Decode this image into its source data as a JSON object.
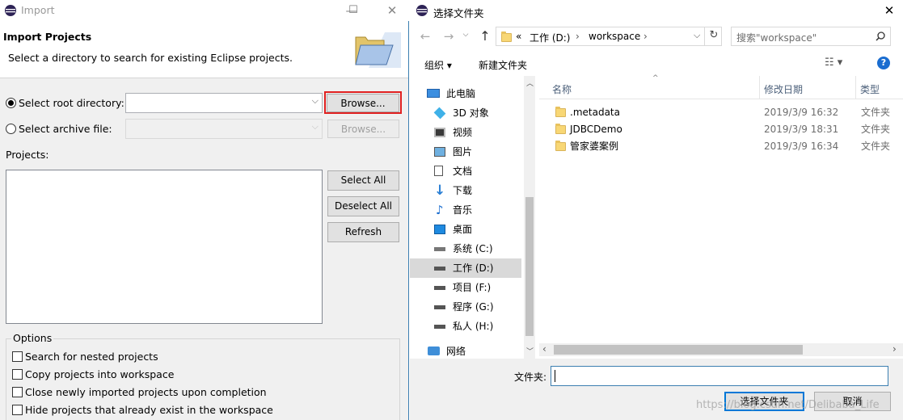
{
  "eclipse": {
    "title": "Import",
    "header_title": "Import Projects",
    "header_desc": "Select a directory to search for existing Eclipse projects.",
    "select_root_label": "Select root directory:",
    "root_value": "",
    "browse_label": "Browse...",
    "select_archive_label": "Select archive file:",
    "archive_value": "",
    "browse_archive_label": "Browse...",
    "projects_label": "Projects:",
    "select_all": "Select All",
    "deselect_all": "Deselect All",
    "refresh": "Refresh",
    "options_label": "Options",
    "options": [
      "Search for nested projects",
      "Copy projects into workspace",
      "Close newly imported projects upon completion",
      "Hide projects that already exist in the workspace"
    ]
  },
  "folder_dialog": {
    "title": "选择文件夹",
    "path": [
      "«",
      "工作 (D:)",
      "workspace"
    ],
    "search_placeholder": "搜索\"workspace\"",
    "organize": "组织 ▾",
    "new_folder": "新建文件夹",
    "tree": [
      {
        "label": "此电脑",
        "icon": "pc-icon"
      },
      {
        "label": "3D 对象",
        "icon": "cube-icon"
      },
      {
        "label": "视频",
        "icon": "video-icon"
      },
      {
        "label": "图片",
        "icon": "picture-icon"
      },
      {
        "label": "文档",
        "icon": "document-icon"
      },
      {
        "label": "下载",
        "icon": "download-icon"
      },
      {
        "label": "音乐",
        "icon": "music-icon"
      },
      {
        "label": "桌面",
        "icon": "desktop-icon"
      },
      {
        "label": "系统 (C:)",
        "icon": "drive-icon"
      },
      {
        "label": "工作 (D:)",
        "icon": "drive-icon"
      },
      {
        "label": "项目 (F:)",
        "icon": "drive-icon"
      },
      {
        "label": "程序 (G:)",
        "icon": "drive-icon"
      },
      {
        "label": "私人 (H:)",
        "icon": "drive-icon"
      },
      {
        "label": "网络",
        "icon": "network-icon"
      }
    ],
    "columns": {
      "name": "名称",
      "modified": "修改日期",
      "type": "类型"
    },
    "files": [
      {
        "name": ".metadata",
        "modified": "2019/3/9 16:32",
        "type": "文件夹"
      },
      {
        "name": "JDBCDemo",
        "modified": "2019/3/9 18:31",
        "type": "文件夹"
      },
      {
        "name": "管家婆案例",
        "modified": "2019/3/9 16:34",
        "type": "文件夹"
      }
    ],
    "folder_label": "文件夹:",
    "folder_value": "",
    "select_folder": "选择文件夹",
    "cancel": "取消",
    "watermark": "https://blog.csdn.net/Delibaba_Life"
  }
}
